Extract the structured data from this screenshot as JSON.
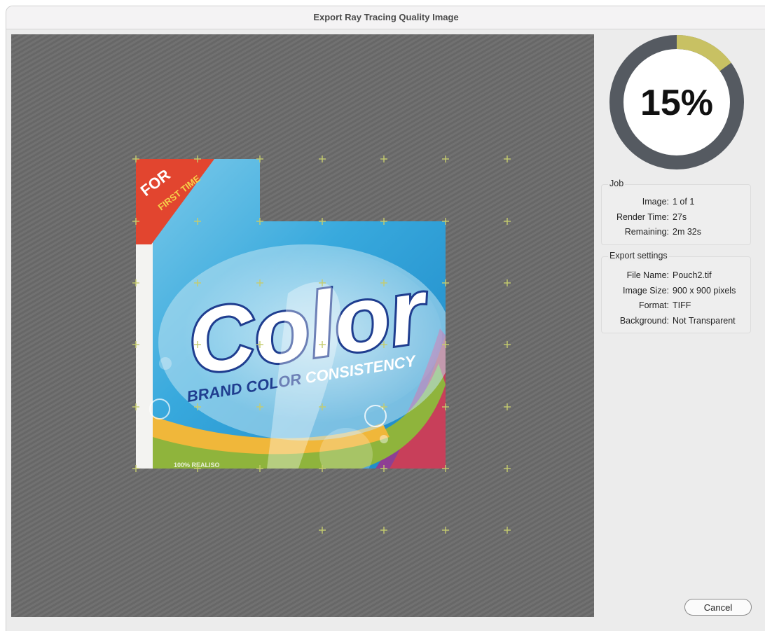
{
  "window": {
    "title": "Export Ray Tracing Quality Image"
  },
  "progress": {
    "percent": 15,
    "label": "15%",
    "colors": {
      "done": "#c8c163",
      "remaining": "#555a61"
    }
  },
  "job": {
    "title": "Job",
    "rows": [
      {
        "label": "Image:",
        "value": "1 of 1"
      },
      {
        "label": "Render Time:",
        "value": "27s"
      },
      {
        "label": "Remaining:",
        "value": "2m 32s"
      }
    ]
  },
  "export_settings": {
    "title": "Export settings",
    "rows": [
      {
        "label": "File Name:",
        "value": "Pouch2.tif"
      },
      {
        "label": "Image Size:",
        "value": "900 x 900 pixels"
      },
      {
        "label": "Format:",
        "value": "TIFF"
      },
      {
        "label": "Background:",
        "value": "Not Transparent"
      }
    ]
  },
  "preview": {
    "label_text": {
      "banner_top": "FOR",
      "banner_bottom": "FIRST TIME",
      "brand": "Color",
      "tagline_part1": "BRAND COLOR ",
      "tagline_part2": "CONSISTENCY",
      "footer": "100% REALISO"
    }
  },
  "buttons": {
    "cancel": "Cancel"
  }
}
